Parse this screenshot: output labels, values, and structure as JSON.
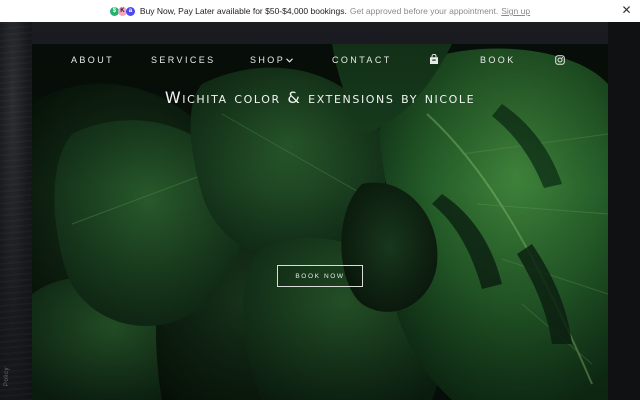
{
  "promo": {
    "main_text": "Buy Now, Pay Later available for $50-$4,000 bookings.",
    "sub_text": "Get approved before your appointment.",
    "link_text": "Sign up",
    "icons": [
      "cash-pay-icon",
      "klarna-icon",
      "affirm-icon"
    ],
    "close_icon": "close-icon"
  },
  "nav": {
    "about": "ABOUT",
    "services": "SERVICES",
    "shop": "SHOP",
    "contact": "CONTACT",
    "book": "BOOK",
    "bag_icon": "shopping-bag-icon",
    "instagram_icon": "instagram-icon"
  },
  "hero": {
    "title": "Wichita color & extensions by nicole",
    "cta_label": "BOOK NOW"
  },
  "side": {
    "policy_text": "Policy"
  },
  "colors": {
    "promo_bg": "#ffffff",
    "page_bg": "#16171b",
    "leaf_dark": "#0f2a16",
    "leaf_mid": "#1f5a2a",
    "leaf_light": "#3c8a3e",
    "text_light": "#e8ece8"
  }
}
